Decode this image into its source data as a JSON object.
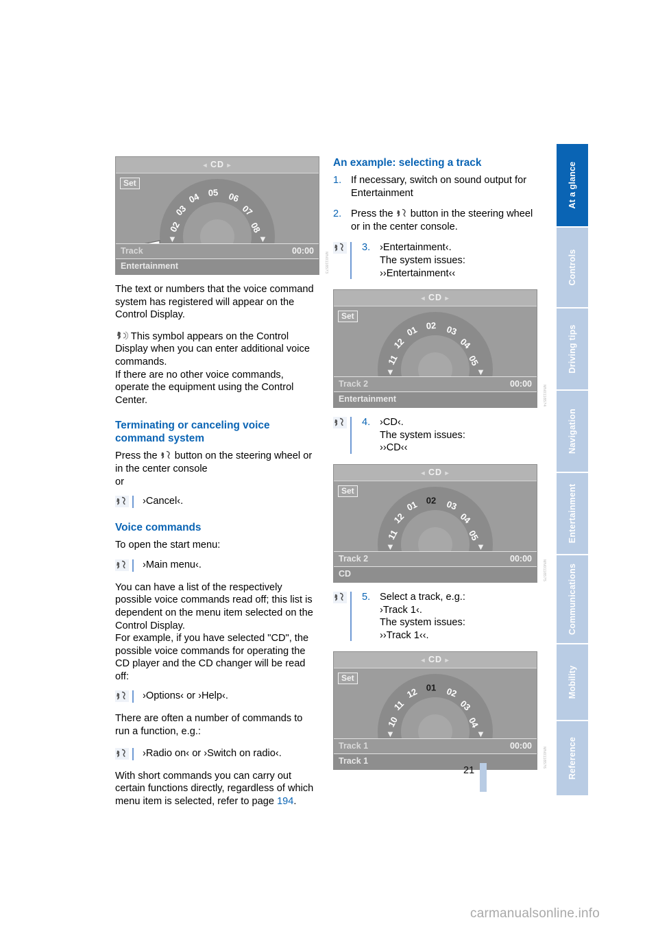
{
  "page": {
    "number": "21",
    "watermark": "carmanualsonline.info"
  },
  "tabs": [
    {
      "label": "At a glance",
      "active": true
    },
    {
      "label": "Controls",
      "active": false
    },
    {
      "label": "Driving tips",
      "active": false
    },
    {
      "label": "Navigation",
      "active": false
    },
    {
      "label": "Entertainment",
      "active": false
    },
    {
      "label": "Communications",
      "active": false
    },
    {
      "label": "Mobility",
      "active": false
    },
    {
      "label": "Reference",
      "active": false
    }
  ],
  "colors": {
    "accent": "#0a64b4",
    "tab_inactive": "#b9cce4",
    "tab_active": "#0a64b4",
    "page_bar": "#b9cce4"
  },
  "left": {
    "shot1_code": "MN0118573",
    "para1": "The text or numbers that the voice command system has registered will appear on the Control Display.",
    "para2a": "This symbol appears on the Control Display when you can enter additional voice commands.",
    "para2b": "If there are no other voice commands, operate the equipment using the Control Center.",
    "heading1": "Terminating or canceling voice command system",
    "para3a": "Press the",
    "para3b": "button on the steering wheel or in the center console",
    "para3c": "or",
    "cmd_cancel": "›Cancel‹.",
    "heading2": "Voice commands",
    "para4": "To open the start menu:",
    "cmd_mainmenu": "›Main menu‹.",
    "para5": "You can have a list of the respectively possible voice commands read off; this list is dependent on the menu item selected on the Control Display.",
    "para6": "For example, if you have selected \"CD\", the possible voice commands for operating the CD player and the CD changer will be read off:",
    "cmd_options": "›Options‹ or ›Help‹.",
    "para7": "There are often a number of commands to run a function, e.g.:",
    "cmd_radio": "›Radio on‹ or ›Switch on radio‹.",
    "para8a": "With short commands you can carry out certain functions directly, regardless of which menu item is selected, refer to page",
    "para8_page": "194",
    "para8b": "."
  },
  "right": {
    "heading": "An example: selecting a track",
    "step1_n": "1.",
    "step1": "If necessary, switch on sound output for Entertainment",
    "step2_n": "2.",
    "step2a": "Press the",
    "step2b": "button in the steering wheel or in the center console.",
    "step3_n": "3.",
    "step3_l1": "›Entertainment‹.",
    "step3_l2": "The system issues:",
    "step3_l3": "››Entertainment‹‹",
    "step4_n": "4.",
    "step4_l1": "›CD‹.",
    "step4_l2": "The system issues:",
    "step4_l3": "››CD‹‹",
    "step5_n": "5.",
    "step5_l1": "Select a track, e.g.:",
    "step5_l2": "›Track 1‹.",
    "step5_l3": "The system issues:",
    "step5_l4": "››Track 1‹‹.",
    "shot2_code": "MN0118574",
    "shot3_code": "MN0118575",
    "shot4_code": "MN0118576"
  },
  "shots": [
    {
      "id": "shot-cd-entertainment-08",
      "title": "CD",
      "set_label": "Set",
      "status_left": "Track",
      "status_right": "00:00",
      "foot_label": "Entertainment",
      "numbers": [
        "02",
        "03",
        "04",
        "05",
        "06",
        "07",
        "08"
      ],
      "selected": "",
      "has_arrow": true
    },
    {
      "id": "shot-cd-entertainment-track2",
      "title": "CD",
      "set_label": "Set",
      "status_left": "Track 2",
      "status_right": "00:00",
      "foot_label": "Entertainment",
      "numbers": [
        "11",
        "12",
        "01",
        "02",
        "03",
        "04",
        "05"
      ],
      "selected": "",
      "has_arrow": false
    },
    {
      "id": "shot-cd-track2-selected",
      "title": "CD",
      "set_label": "Set",
      "status_left": "Track 2",
      "status_right": "00:00",
      "foot_label": "CD",
      "numbers": [
        "11",
        "12",
        "01",
        "02",
        "03",
        "04",
        "05"
      ],
      "selected": "02",
      "has_arrow": false
    },
    {
      "id": "shot-cd-track1-selected",
      "title": "CD",
      "set_label": "Set",
      "status_left": "Track 1",
      "status_right": "00:00",
      "foot_label": "Track 1",
      "numbers": [
        "10",
        "11",
        "12",
        "01",
        "02",
        "03",
        "04"
      ],
      "selected": "01",
      "has_arrow": false
    }
  ]
}
